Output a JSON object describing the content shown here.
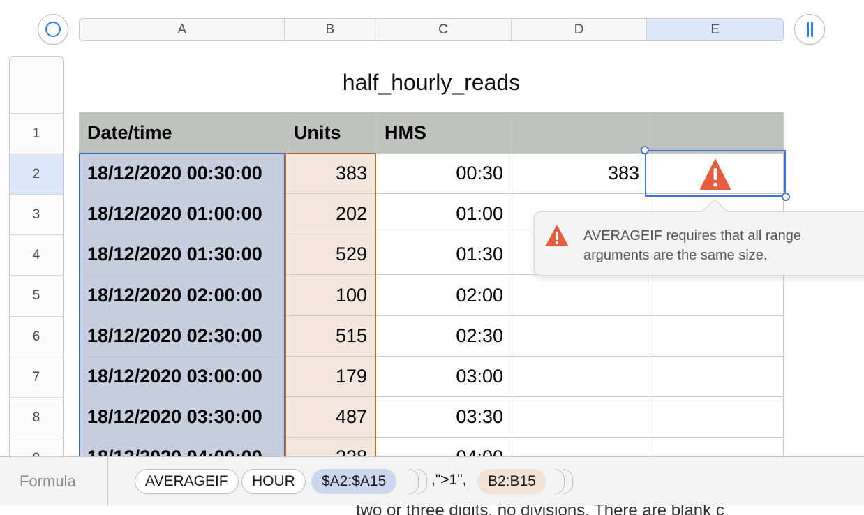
{
  "toolbar": {
    "left_icon": "ring-select-icon",
    "right_icon": "freeze-columns-icon"
  },
  "columns": [
    "A",
    "B",
    "C",
    "D",
    "E"
  ],
  "rows": [
    "1",
    "2",
    "3",
    "4",
    "5",
    "6",
    "7",
    "8",
    "9"
  ],
  "sheet": {
    "title": "half_hourly_reads",
    "headers": [
      "Date/time",
      "Units",
      "HMS",
      "",
      ""
    ],
    "data": [
      [
        "18/12/2020 00:30:00",
        "383",
        "00:30",
        "383"
      ],
      [
        "18/12/2020 01:00:00",
        "202",
        "01:00",
        ""
      ],
      [
        "18/12/2020 01:30:00",
        "529",
        "01:30",
        ""
      ],
      [
        "18/12/2020 02:00:00",
        "100",
        "02:00",
        ""
      ],
      [
        "18/12/2020 02:30:00",
        "515",
        "02:30",
        ""
      ],
      [
        "18/12/2020 03:00:00",
        "179",
        "03:00",
        ""
      ],
      [
        "18/12/2020 03:30:00",
        "487",
        "03:30",
        ""
      ],
      [
        "18/12/2020 04:00:00",
        "228",
        "04:00",
        ""
      ]
    ]
  },
  "error": {
    "message": "AVERAGEIF requires that all range arguments are the same size."
  },
  "formula_bar": {
    "label": "Formula",
    "tokens": {
      "func": "AVERAGEIF",
      "inner_func": "HOUR",
      "range_a": "$A2:$A15",
      "criteria": ",\">1\",",
      "range_b": "B2:B15"
    }
  },
  "background_text": "two or three digits, no divisions. There are blank c",
  "colors": {
    "accent": "#2f7bf5",
    "range_a": "#3d6bc4",
    "range_b": "#c06a2a",
    "warning": "#e45d3e"
  }
}
